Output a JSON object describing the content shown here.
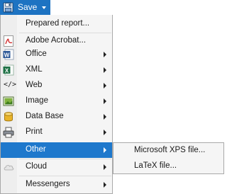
{
  "toolbar": {
    "save_label": "Save",
    "save_icon": "floppy-disk-icon"
  },
  "menu": {
    "items": [
      {
        "label": "Prepared report...",
        "icon": "none",
        "submenu": false
      },
      {
        "label": "Adobe Acrobat...",
        "icon": "pdf-icon",
        "submenu": false
      },
      {
        "label": "Office",
        "icon": "word-icon",
        "submenu": true
      },
      {
        "label": "XML",
        "icon": "excel-icon",
        "submenu": true
      },
      {
        "label": "Web",
        "icon": "code-icon",
        "submenu": true
      },
      {
        "label": "Image",
        "icon": "image-icon",
        "submenu": true
      },
      {
        "label": "Data Base",
        "icon": "database-icon",
        "submenu": true
      },
      {
        "label": "Print",
        "icon": "printer-icon",
        "submenu": true
      },
      {
        "label": "Other",
        "icon": "none",
        "submenu": true,
        "selected": true
      },
      {
        "label": "Cloud",
        "icon": "cloud-icon",
        "submenu": true
      },
      {
        "label": "Messengers",
        "icon": "none",
        "submenu": true
      }
    ],
    "other_submenu": [
      {
        "label": "Microsoft XPS file..."
      },
      {
        "label": "LaTeX file..."
      }
    ]
  },
  "colors": {
    "accent": "#1e78cc",
    "menu_bg": "#f5f5f5",
    "pdf": "#d12f2f",
    "word": "#2b5797",
    "excel": "#1e7145"
  }
}
